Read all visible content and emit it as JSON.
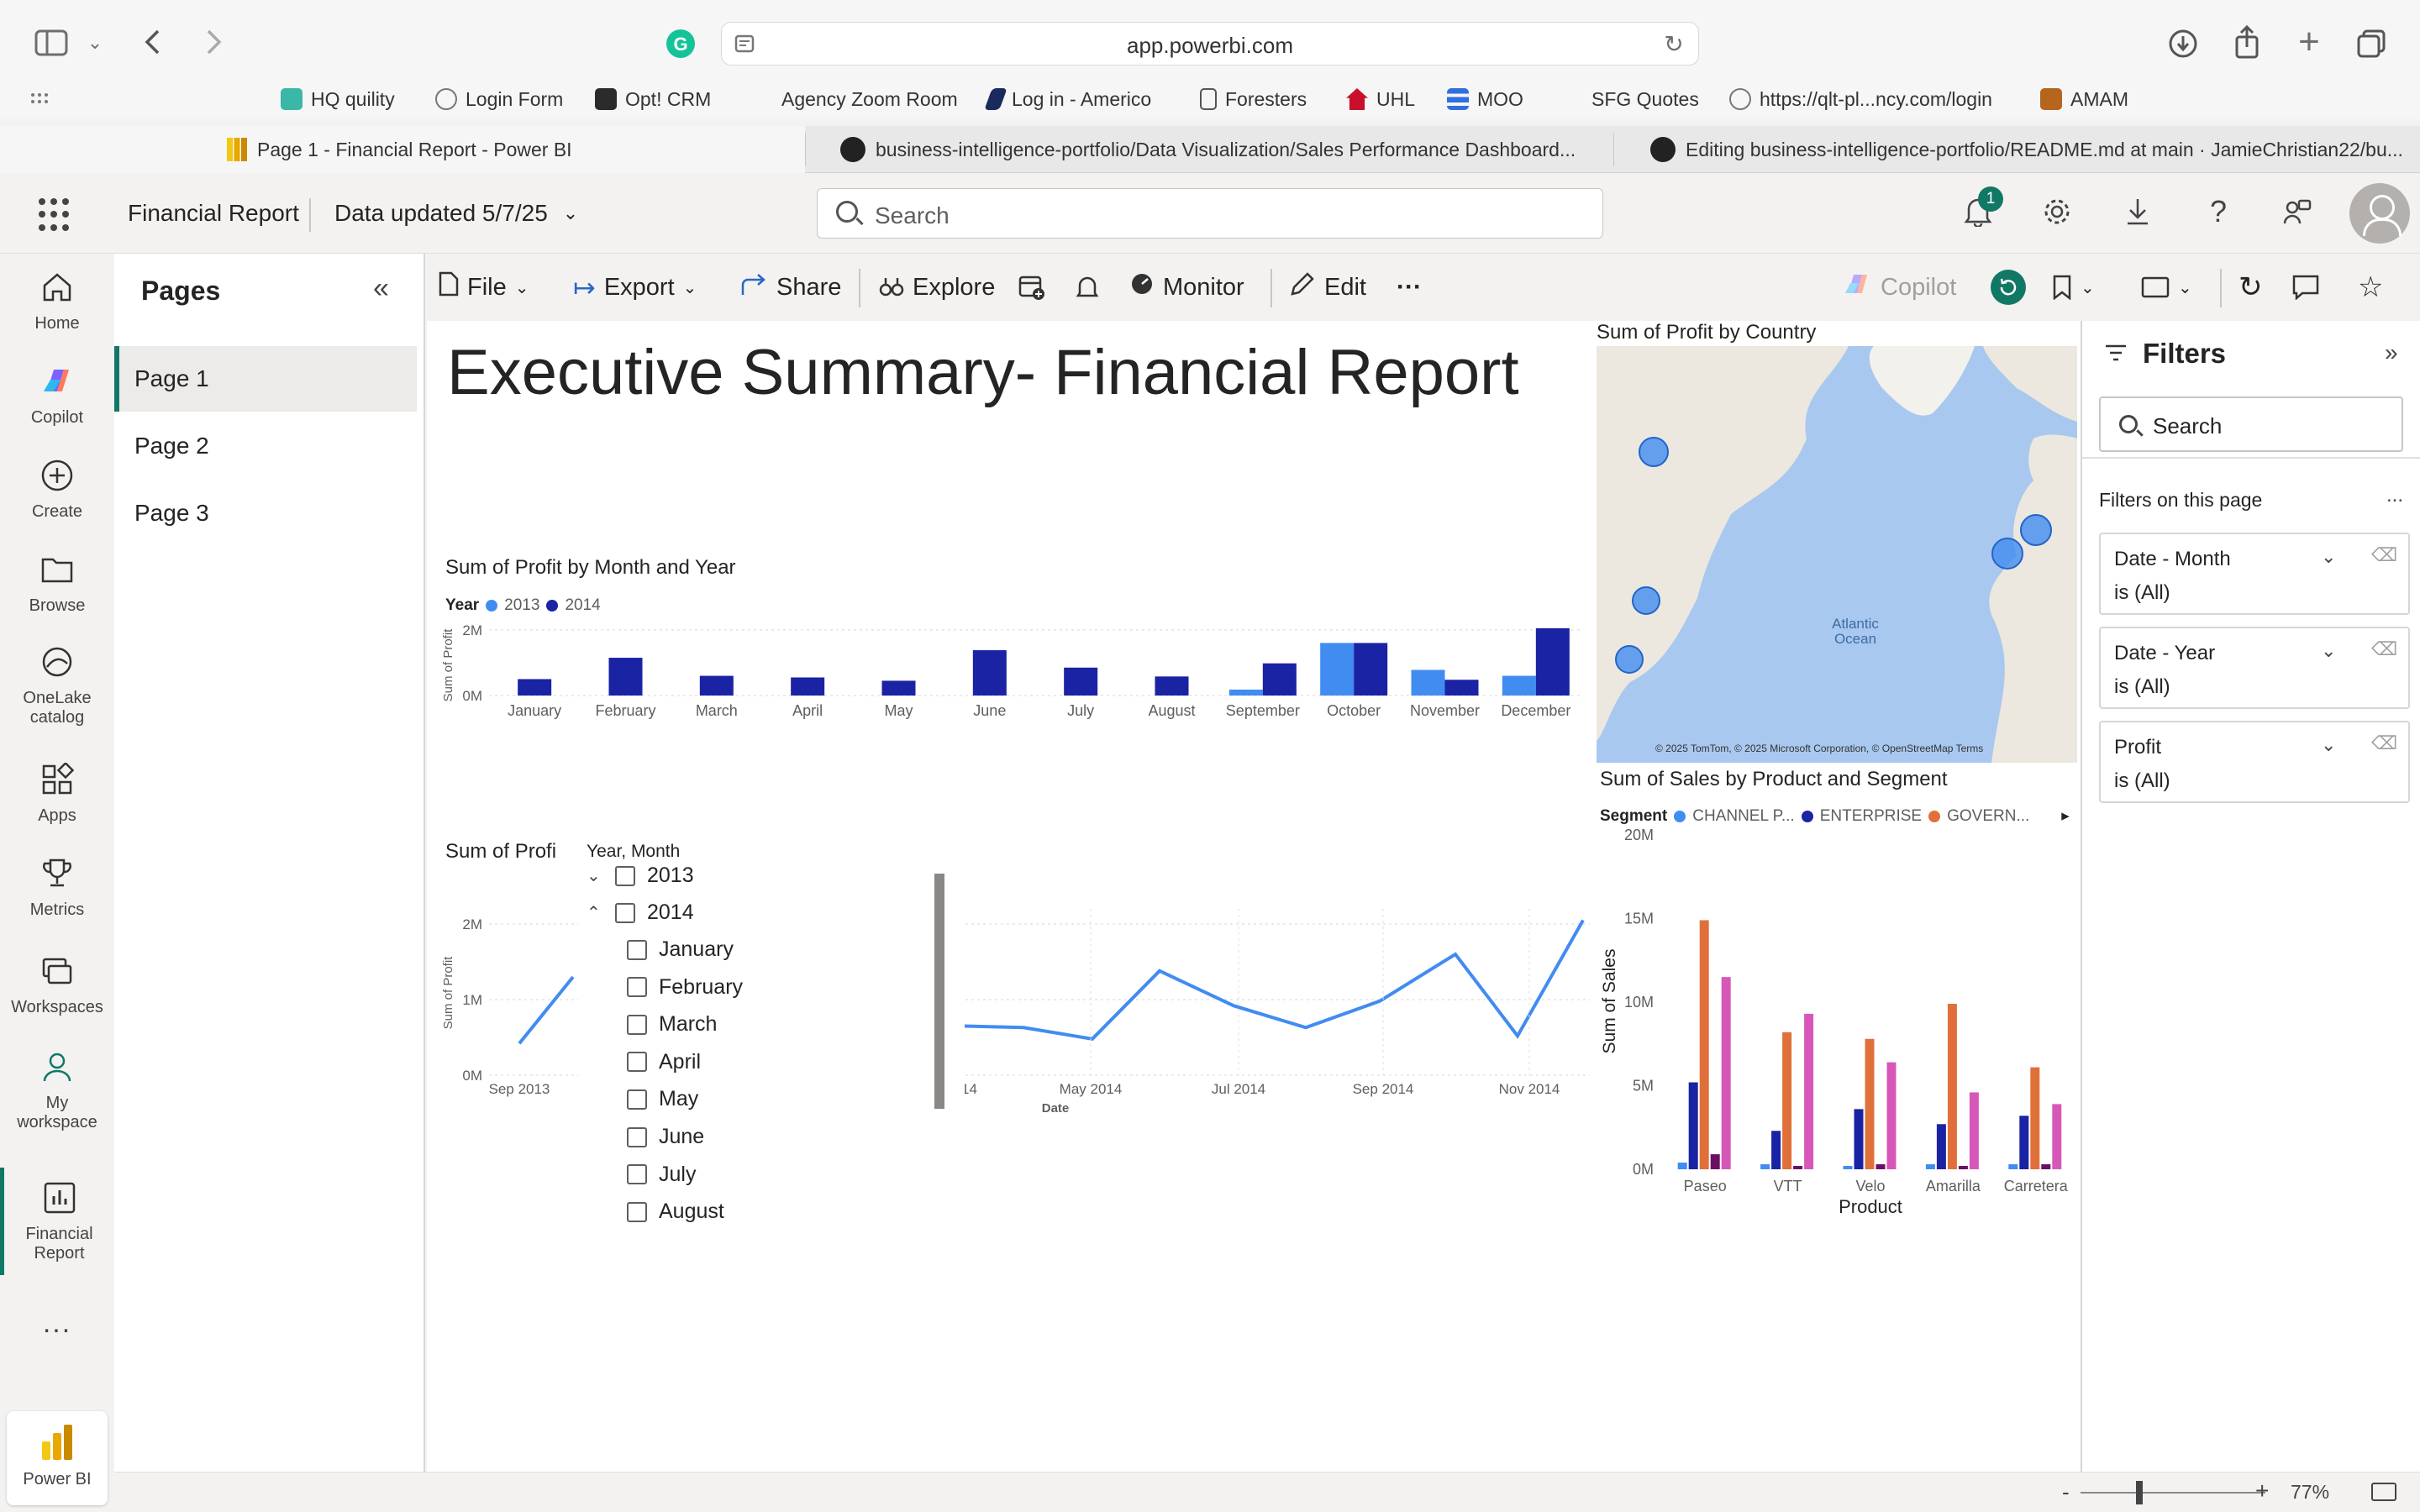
{
  "browser": {
    "url": "app.powerbi.com",
    "bookmarks": [
      "HQ quility",
      "Login Form",
      "Opt! CRM",
      "Agency Zoom Room",
      "Log in - Americo",
      "Foresters",
      "UHL",
      "MOO",
      "SFG Quotes",
      "https://qlt-pl...ncy.com/login",
      "AMAM"
    ],
    "tabs": [
      "Page 1 - Financial Report - Power BI",
      "business-intelligence-portfolio/Data Visualization/Sales Performance Dashboard...",
      "Editing business-intelligence-portfolio/README.md at main · JamieChristian22/bu..."
    ]
  },
  "header": {
    "report_name": "Financial Report",
    "data_updated": "Data updated 5/7/25",
    "search_placeholder": "Search",
    "notification_count": "1"
  },
  "left_nav": {
    "items": [
      "Home",
      "Copilot",
      "Create",
      "Browse",
      "OneLake catalog",
      "Apps",
      "Metrics",
      "Workspaces",
      "My workspace",
      "Financial Report"
    ],
    "more": "...",
    "footer_label": "Power BI"
  },
  "pages_pane": {
    "title": "Pages",
    "pages": [
      "Page 1",
      "Page 2",
      "Page 3"
    ],
    "active": "Page 1"
  },
  "toolbar": {
    "file": "File",
    "export": "Export",
    "share": "Share",
    "explore": "Explore",
    "monitor": "Monitor",
    "edit": "Edit",
    "more": "···",
    "copilot": "Copilot"
  },
  "report": {
    "title": "Executive Summary- Financial Report"
  },
  "colors": {
    "year_2013": "#418cf0",
    "year_2014": "#1a23a3",
    "channel_partners": "#418cf0",
    "enterprise": "#1a23a3",
    "government": "#e0703a",
    "midmarket": "#6b0f66",
    "small_business": "#d757b9",
    "accent": "#117865"
  },
  "chart_data": [
    {
      "id": "profit_by_month_year",
      "type": "bar",
      "title": "Sum of Profit by Month and Year",
      "legend_title": "Year",
      "ylabel": "Sum of Profit",
      "xlabel": "",
      "categories": [
        "January",
        "February",
        "March",
        "April",
        "May",
        "June",
        "July",
        "August",
        "September",
        "October",
        "November",
        "December"
      ],
      "series": [
        {
          "name": "2013",
          "values": [
            0,
            0,
            0,
            0,
            0,
            0,
            0,
            0,
            0.18,
            1.6,
            0.78,
            0.6
          ]
        },
        {
          "name": "2014",
          "values": [
            0.5,
            1.15,
            0.6,
            0.55,
            0.45,
            1.38,
            0.85,
            0.58,
            0.98,
            1.6,
            0.48,
            2.05
          ]
        }
      ],
      "ylim": [
        0,
        2.2
      ],
      "yticks": [
        "0M",
        "2M"
      ],
      "grid": true,
      "legend_position": "top-left"
    },
    {
      "id": "profit_over_time",
      "type": "line",
      "title": "Sum of Profi",
      "ylabel": "Sum of Profit",
      "xlabel": "Date",
      "yticks": [
        "0M",
        "1M",
        "2M"
      ],
      "ylim": [
        0,
        2.2
      ],
      "x": [
        "Sep 2013",
        "Oct 2013",
        "Nov 2013",
        "Dec 2013",
        "Jan 2014",
        "Feb 2014",
        "Mar 2014",
        "Apr 2014",
        "May 2014",
        "Jun 2014",
        "Jul 2014",
        "Aug 2014",
        "Sep 2014",
        "Oct 2014",
        "Nov 2014",
        "Dec 2014"
      ],
      "values": [
        0.42,
        1.3,
        0,
        0,
        0.65,
        0.63,
        0.48,
        1.38,
        0.92,
        0.63,
        0.98,
        1.6,
        0.52,
        2.05
      ],
      "xticks_visible": [
        "Sep 2013",
        "14",
        "May 2014",
        "Jul 2014",
        "Sep 2014",
        "Nov 2014"
      ],
      "grid": true
    },
    {
      "id": "sales_by_product_segment",
      "type": "bar",
      "title": "Sum of Sales by Product and Segment",
      "legend_title": "Segment",
      "legend_visible": [
        "CHANNEL P...",
        "ENTERPRISE",
        "GOVERN..."
      ],
      "ylabel": "Sum of Sales",
      "xlabel": "Product",
      "categories": [
        "Paseo",
        "VTT",
        "Velo",
        "Amarilla",
        "Carretera"
      ],
      "series": [
        {
          "name": "CHANNEL P...",
          "values": [
            0.4,
            0.3,
            0.2,
            0.3,
            0.3
          ]
        },
        {
          "name": "ENTERPRISE",
          "values": [
            5.2,
            2.3,
            3.6,
            2.7,
            3.2
          ]
        },
        {
          "name": "GOVERN...",
          "values": [
            14.9,
            8.2,
            7.8,
            9.9,
            6.1
          ]
        },
        {
          "name": "",
          "values": [
            0.9,
            0.2,
            0.3,
            0.2,
            0.3
          ]
        },
        {
          "name": "",
          "values": [
            11.5,
            9.3,
            6.4,
            4.6,
            3.9
          ]
        }
      ],
      "ylim": [
        0,
        20
      ],
      "yticks": [
        "0M",
        "5M",
        "10M",
        "15M",
        "20M"
      ],
      "grid": false,
      "legend_position": "top-left"
    },
    {
      "id": "profit_by_country",
      "type": "map",
      "title": "Sum of Profit by Country",
      "label_ocean": "Atlantic Ocean",
      "attribution": "© 2025 TomTom, © 2025 Microsoft Corporation, © OpenStreetMap   Terms"
    }
  ],
  "slicer": {
    "header": "Year, Month",
    "years": [
      "2013",
      "2014"
    ],
    "months": [
      "January",
      "February",
      "March",
      "April",
      "May",
      "June",
      "July",
      "August"
    ]
  },
  "filters": {
    "title": "Filters",
    "search_placeholder": "Search",
    "section": "Filters on this page",
    "section_more": "...",
    "cards": [
      {
        "name": "Date - Month",
        "value": "is (All)"
      },
      {
        "name": "Date - Year",
        "value": "is (All)"
      },
      {
        "name": "Profit",
        "value": "is (All)"
      }
    ]
  },
  "status": {
    "zoom": "77%",
    "zoom_minus": "-",
    "zoom_plus": "+"
  }
}
